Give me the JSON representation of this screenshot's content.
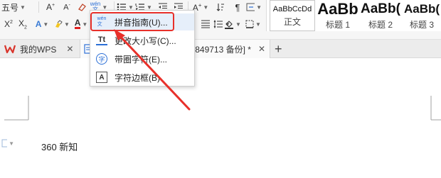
{
  "ribbon": {
    "font_size": "五号",
    "style_gallery": [
      {
        "sample": "AaBbCcDd",
        "name": "正文"
      },
      {
        "sample": "AaBb",
        "name": "标题 1"
      },
      {
        "sample": "AaBb(",
        "name": "标题 2"
      },
      {
        "sample": "AaBb(",
        "name": "标题 3"
      }
    ]
  },
  "tabs": {
    "home_tab": "我的WPS",
    "doc_tab": "849713 备份] *",
    "new_tab_glyph": "+"
  },
  "menu": {
    "items": [
      {
        "label": "拼音指南(U)...",
        "icon": "pinyin-icon"
      },
      {
        "label": "更改大小写(C)...",
        "icon": "change-case-icon"
      },
      {
        "label": "带圈字符(E)...",
        "icon": "enclosed-char-icon"
      },
      {
        "label": "字符边框(B)",
        "icon": "char-border-icon"
      }
    ]
  },
  "document": {
    "body_text": "360 新知"
  },
  "colors": {
    "annotation_red": "#e8302a",
    "menu_highlight": "#e6effa",
    "accent_blue": "#2b6fd6"
  }
}
